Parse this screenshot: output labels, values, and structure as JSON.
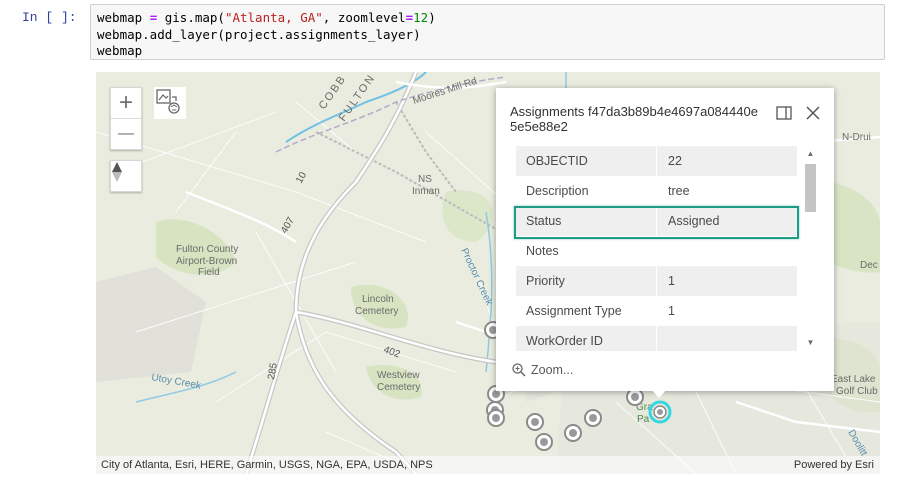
{
  "cell": {
    "prompt": "In [  ]:",
    "code": [
      {
        "tokens": [
          {
            "t": "webmap "
          },
          {
            "t": "=",
            "c": "op"
          },
          {
            "t": " gis.map("
          },
          {
            "t": "\"Atlanta, GA\"",
            "c": "str"
          },
          {
            "t": ", zoomlevel"
          },
          {
            "t": "=",
            "c": "op"
          },
          {
            "t": "12",
            "c": "num"
          },
          {
            "t": ")"
          }
        ]
      },
      {
        "tokens": [
          {
            "t": "webmap.add_layer(project.assignments_layer)"
          }
        ]
      },
      {
        "tokens": [
          {
            "t": "webmap"
          }
        ]
      }
    ]
  },
  "map": {
    "zoom_in": "+",
    "zoom_out": "—",
    "labels": {
      "cobb": "COBB",
      "fulton": "FULTON",
      "moores_mill": "Moores Mill Rd",
      "ns": "NS",
      "inman": "Inman",
      "airport_1": "Fulton County",
      "airport_2": "Airport-Brown",
      "airport_3": "Field",
      "lincoln_1": "Lincoln",
      "lincoln_2": "Cemetery",
      "westview_1": "Westview",
      "westview_2": "Cemetery",
      "proctor": "Proctor Creek",
      "utoy": "Utoy Creek",
      "r10": "10",
      "r407": "407",
      "r402": "402",
      "r285": "285",
      "n_druid": "N-Drui",
      "dec": "Dec",
      "east_lake_1": "East Lake",
      "east_lake_2": "Golf Club",
      "doolittle": "Doolitt",
      "grant_1": "Gra",
      "grant_2": "Pa"
    },
    "attribution": "City of Atlanta, Esri, HERE, Garmin, USGS, NGA, EPA, USDA, NPS",
    "powered_by": "Powered by Esri"
  },
  "popup": {
    "title": "Assignments f47da3b89b4e4697a084440e5e5e88e2",
    "rows": [
      {
        "key": "OBJECTID",
        "value": "22"
      },
      {
        "key": "Description",
        "value": "tree"
      },
      {
        "key": "Status",
        "value": "Assigned"
      },
      {
        "key": "Notes",
        "value": ""
      },
      {
        "key": "Priority",
        "value": "1"
      },
      {
        "key": "Assignment Type",
        "value": "1"
      },
      {
        "key": "WorkOrder ID",
        "value": ""
      }
    ],
    "zoom_label": "Zoom...",
    "highlight_color": "#1f9b86"
  }
}
